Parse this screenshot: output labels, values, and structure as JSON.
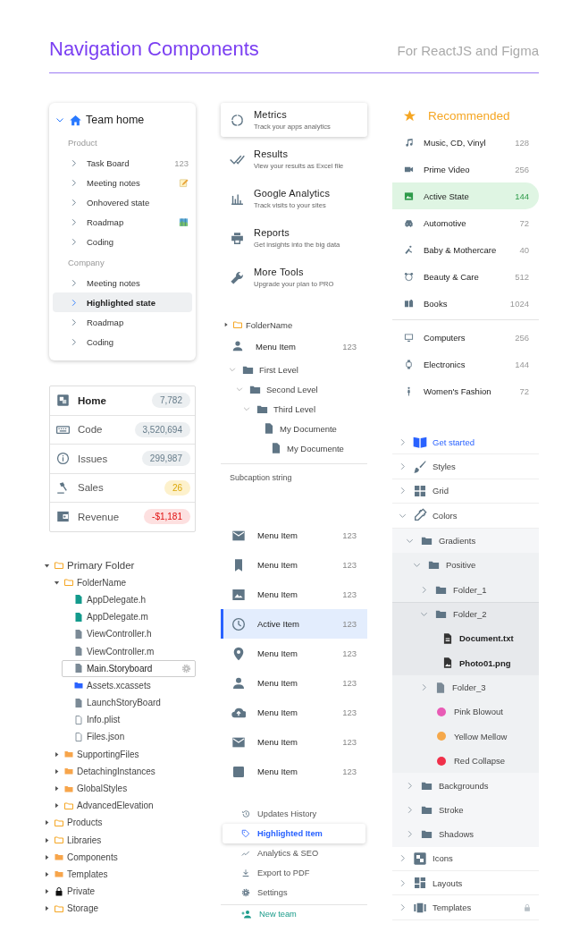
{
  "header": {
    "title": "Navigation Components",
    "subtitle": "For ReactJS and Figma"
  },
  "team_nav": {
    "title": "Team home",
    "expanded": true,
    "sections": [
      {
        "caption": "Product",
        "items": [
          {
            "label": "Task Board",
            "count": "123",
            "selected": false
          },
          {
            "label": "Meeting notes",
            "selected": false
          },
          {
            "label": "Onhovered state",
            "selected": false
          },
          {
            "label": "Roadmap",
            "selected": false
          },
          {
            "label": "Coding",
            "selected": false
          }
        ]
      },
      {
        "caption": "Company",
        "items": [
          {
            "label": "Meeting notes",
            "selected": false
          },
          {
            "label": "Highlighted state",
            "selected": true
          },
          {
            "label": "Roadmap",
            "selected": false
          },
          {
            "label": "Coding",
            "selected": false
          }
        ]
      }
    ]
  },
  "stats": [
    {
      "label": "Home",
      "count": "7,782",
      "color": "#eceff1",
      "selected": true
    },
    {
      "label": "Code",
      "count": "3,520,694",
      "color": "#eceff1",
      "selected": false
    },
    {
      "label": "Issues",
      "count": "299,987",
      "color": "#eceff1",
      "selected": false
    },
    {
      "label": "Sales",
      "count": "26",
      "color": "#fdf1cc",
      "selected": false
    },
    {
      "label": "Revenue",
      "count": "-$1,181",
      "color": "#fde0e0",
      "selected": false
    }
  ],
  "file_tree": [
    {
      "label": "Primary Folder",
      "kind": "folder",
      "expanded": true,
      "selected": false,
      "children": [
        {
          "label": "FolderName",
          "kind": "folder",
          "expanded": true,
          "selected": false,
          "children": [
            {
              "label": "AppDelegate.h",
              "kind": "source",
              "selected": false
            },
            {
              "label": "AppDelegate.m",
              "kind": "source",
              "selected": false
            },
            {
              "label": "ViewController.h",
              "kind": "script",
              "selected": false
            },
            {
              "label": "ViewController.m",
              "kind": "script",
              "selected": false
            },
            {
              "label": "Main.Storyboard",
              "kind": "script",
              "selected": true
            },
            {
              "label": "Assets.xcassets",
              "kind": "asset",
              "selected": false
            },
            {
              "label": "LaunchStoryBoard",
              "kind": "script",
              "selected": false
            },
            {
              "label": "Info.plist",
              "kind": "plain",
              "selected": false
            },
            {
              "label": "Files.json",
              "kind": "plain",
              "selected": false
            }
          ]
        },
        {
          "label": "SupportingFiles",
          "kind": "shared",
          "expanded": false,
          "selected": false
        },
        {
          "label": "DetachingInstances",
          "kind": "shared",
          "expanded": false,
          "selected": false
        },
        {
          "label": "GlobalStyles",
          "kind": "shared",
          "expanded": false,
          "selected": false
        },
        {
          "label": "AdvancedElevation",
          "kind": "folder",
          "expanded": false,
          "selected": false
        }
      ]
    },
    {
      "label": "Products",
      "kind": "folder",
      "expanded": false,
      "selected": false
    },
    {
      "label": "Libraries",
      "kind": "folder",
      "expanded": false,
      "selected": false
    },
    {
      "label": "Components",
      "kind": "shared",
      "expanded": false,
      "selected": false
    },
    {
      "label": "Templates",
      "kind": "shared",
      "expanded": false,
      "selected": false
    },
    {
      "label": "Private",
      "kind": "locked",
      "expanded": false,
      "selected": false
    },
    {
      "label": "Storage",
      "kind": "folder",
      "expanded": false,
      "selected": false
    }
  ],
  "tools": [
    {
      "title": "Metrics",
      "subtitle": "Track your apps analytics",
      "selected": true
    },
    {
      "title": "Results",
      "subtitle": "View your results as Excel file",
      "selected": false
    },
    {
      "title": "Google Analytics",
      "subtitle": "Track visits to your sites",
      "selected": false
    },
    {
      "title": "Reports",
      "subtitle": "Get insights into the big data",
      "selected": false
    },
    {
      "title": "More Tools",
      "subtitle": "Upgrade your plan to PRO",
      "selected": false
    }
  ],
  "folder_row": {
    "label": "FolderName",
    "expanded": false
  },
  "menu_row": {
    "label": "Menu Item",
    "count": "123"
  },
  "level_tree": [
    {
      "label": "First Level",
      "kind": "folder",
      "expanded": true,
      "children": [
        {
          "label": "Second Level",
          "kind": "folder",
          "expanded": true,
          "children": [
            {
              "label": "Third Level",
              "kind": "folder",
              "expanded": true,
              "children": [
                {
                  "label": "My Documente",
                  "kind": "document",
                  "children": [
                    {
                      "label": "My Documente",
                      "kind": "document"
                    }
                  ]
                }
              ]
            }
          ]
        }
      ]
    }
  ],
  "subcaption": "Subcaption string",
  "menu_list": [
    {
      "label": "Menu Item",
      "count": "123",
      "selected": false
    },
    {
      "label": "Menu Item",
      "count": "123",
      "selected": false
    },
    {
      "label": "Menu Item",
      "count": "123",
      "selected": false
    },
    {
      "label": "Active Item",
      "count": "123",
      "selected": true
    },
    {
      "label": "Menu Item",
      "count": "123",
      "selected": false
    },
    {
      "label": "Menu Item",
      "count": "123",
      "selected": false
    },
    {
      "label": "Menu Item",
      "count": "123",
      "selected": false
    },
    {
      "label": "Menu Item",
      "count": "123",
      "selected": false
    },
    {
      "label": "Menu Item",
      "count": "123",
      "selected": false
    }
  ],
  "side_nav": {
    "items": [
      {
        "label": "Updates History",
        "selected": false
      },
      {
        "label": "Highlighted Item",
        "selected": true
      },
      {
        "label": "Analytics & SEO",
        "selected": false
      },
      {
        "label": "Export to PDF",
        "selected": false
      },
      {
        "label": "Settings",
        "selected": false
      }
    ],
    "action": "New team"
  },
  "categories": {
    "title": "Recommended",
    "groups": [
      {
        "items": [
          {
            "label": "Music, CD, Vinyl",
            "count": "128",
            "selected": false
          },
          {
            "label": "Prime Video",
            "count": "256",
            "selected": false
          },
          {
            "label": "Active State",
            "count": "144",
            "selected": true
          },
          {
            "label": "Automotive",
            "count": "72",
            "selected": false
          },
          {
            "label": "Baby & Mothercare",
            "count": "40",
            "selected": false
          },
          {
            "label": "Beauty & Care",
            "count": "512",
            "selected": false
          },
          {
            "label": "Books",
            "count": "1024",
            "selected": false
          }
        ]
      },
      {
        "items": [
          {
            "label": "Computers",
            "count": "256",
            "selected": false
          },
          {
            "label": "Electronics",
            "count": "144",
            "selected": false
          },
          {
            "label": "Women's Fashion",
            "count": "72",
            "selected": false
          }
        ]
      }
    ]
  },
  "docs_tree": [
    {
      "label": "Get started",
      "kind": "section",
      "expanded": false,
      "selected": true,
      "locked": false
    },
    {
      "label": "Styles",
      "kind": "section",
      "expanded": false,
      "selected": false,
      "locked": false
    },
    {
      "label": "Grid",
      "kind": "section",
      "expanded": false,
      "selected": false,
      "locked": false
    },
    {
      "label": "Colors",
      "kind": "section",
      "expanded": true,
      "selected": false,
      "locked": false,
      "children": [
        {
          "label": "Gradients",
          "kind": "folder",
          "expanded": true,
          "selected": false,
          "children": [
            {
              "label": "Positive",
              "kind": "folder",
              "expanded": true,
              "selected": false,
              "children": [
                {
                  "label": "Folder_1",
                  "kind": "folder",
                  "expanded": false,
                  "selected": false
                },
                {
                  "label": "Folder_2",
                  "kind": "folder",
                  "expanded": true,
                  "selected": true,
                  "children": [
                    {
                      "label": "Document.txt",
                      "kind": "text",
                      "selected": false
                    },
                    {
                      "label": "Photo01.png",
                      "kind": "image",
                      "selected": false
                    }
                  ]
                },
                {
                  "label": "Folder_3",
                  "kind": "file",
                  "expanded": false,
                  "selected": false
                },
                {
                  "label": "Pink Blowout",
                  "kind": "color",
                  "color": "#e85bb5",
                  "selected": false
                },
                {
                  "label": "Yellow Mellow",
                  "kind": "color",
                  "color": "#f5a84a",
                  "selected": false
                },
                {
                  "label": "Red Collapse",
                  "kind": "color",
                  "color": "#f0304a",
                  "selected": false
                }
              ]
            }
          ]
        },
        {
          "label": "Backgrounds",
          "kind": "folder",
          "expanded": false,
          "selected": false
        },
        {
          "label": "Stroke",
          "kind": "folder",
          "expanded": false,
          "selected": false
        },
        {
          "label": "Shadows",
          "kind": "folder",
          "expanded": false,
          "selected": false
        }
      ]
    },
    {
      "label": "Icons",
      "kind": "section",
      "expanded": false,
      "selected": false,
      "locked": false
    },
    {
      "label": "Layouts",
      "kind": "section",
      "expanded": false,
      "selected": false,
      "locked": false
    },
    {
      "label": "Templates",
      "kind": "section",
      "expanded": false,
      "selected": false,
      "locked": true
    }
  ]
}
